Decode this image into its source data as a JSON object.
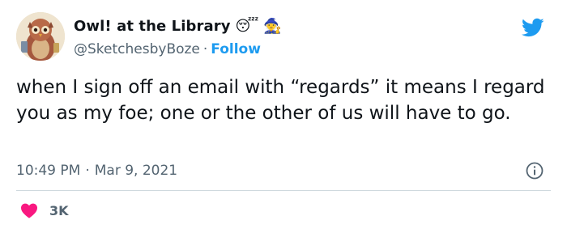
{
  "tweet": {
    "display_name": "Owl! at the Library",
    "name_emojis": [
      "😴",
      "🧙"
    ],
    "handle": "@SketchesbyBoze",
    "separator": "·",
    "follow_label": "Follow",
    "text": "when I sign off an email with “regards” it means I regard you as my foe; one or the other of us will have to go.",
    "time": "10:49 PM",
    "date": "Mar 9, 2021",
    "like_count": "3K"
  },
  "icons": {
    "avatar": "owl-avatar",
    "platform": "twitter-bird-icon",
    "info": "info-icon",
    "like": "heart-icon"
  },
  "colors": {
    "accent": "#1d9bf0",
    "like": "#f91880",
    "secondary_text": "#536471",
    "divider": "#cfd9de"
  }
}
